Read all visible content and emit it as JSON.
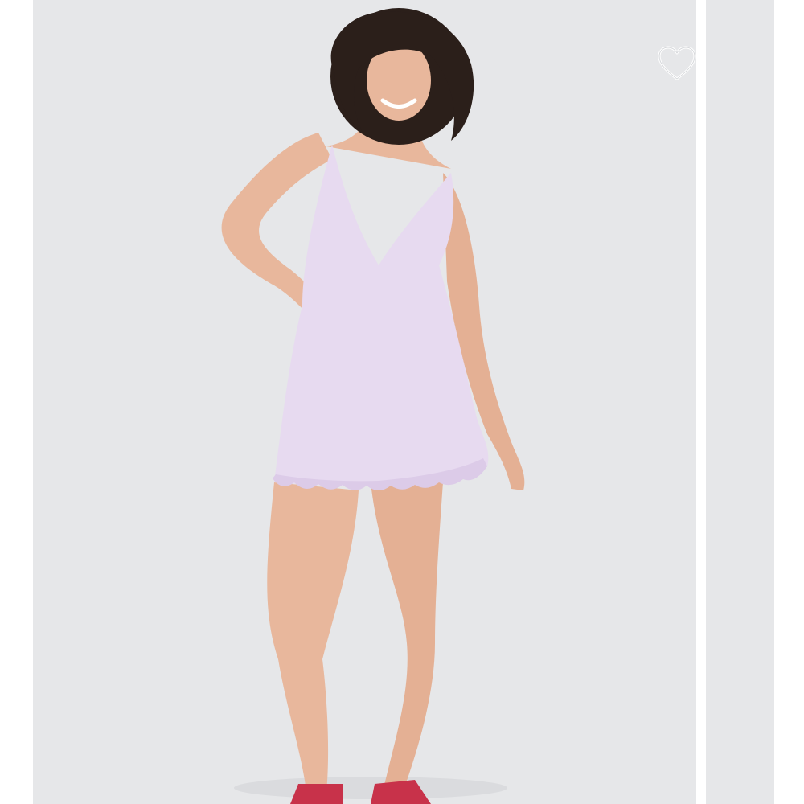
{
  "gallery": {
    "main_image": {
      "subject": "model-in-lilac-ruffle-hem-mini-dress",
      "background_color": "#e6e7e9",
      "dress_color": "#e7daf0"
    },
    "wishlist": {
      "icon": "heart-outline-icon",
      "color": "#ffffff"
    }
  }
}
